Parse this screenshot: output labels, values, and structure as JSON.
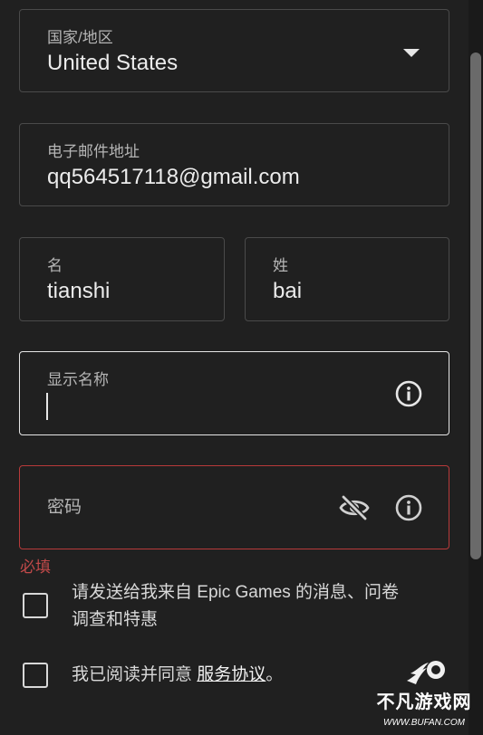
{
  "form": {
    "country": {
      "label": "国家/地区",
      "value": "United States"
    },
    "email": {
      "label": "电子邮件地址",
      "value": "qq564517118@gmail.com"
    },
    "first_name": {
      "label": "名",
      "value": "tianshi"
    },
    "last_name": {
      "label": "姓",
      "value": "bai"
    },
    "display_name": {
      "label": "显示名称",
      "value": ""
    },
    "password": {
      "label": "密码",
      "value": "",
      "required_hint": "必填"
    }
  },
  "checkboxes": {
    "marketing": {
      "label_line1": "请发送给我来自 Epic Games 的消息、问卷",
      "label_line2": "调查和特惠",
      "checked": false
    },
    "terms": {
      "label_prefix": "我已阅读并同意 ",
      "link": "服务协议",
      "label_suffix": "。",
      "checked": false
    }
  },
  "watermark": {
    "title": "不凡游戏网",
    "url": "WWW.BUFAN.COM"
  },
  "icons": {
    "dropdown": "chevron-down-icon",
    "info": "info-icon",
    "password_visibility": "eye-slash-icon",
    "logo": "bufan-logo-icon"
  },
  "colors": {
    "background": "#202020",
    "border": "#4a4a4a",
    "error": "#b83a3a",
    "text": "#e8e8e8"
  }
}
